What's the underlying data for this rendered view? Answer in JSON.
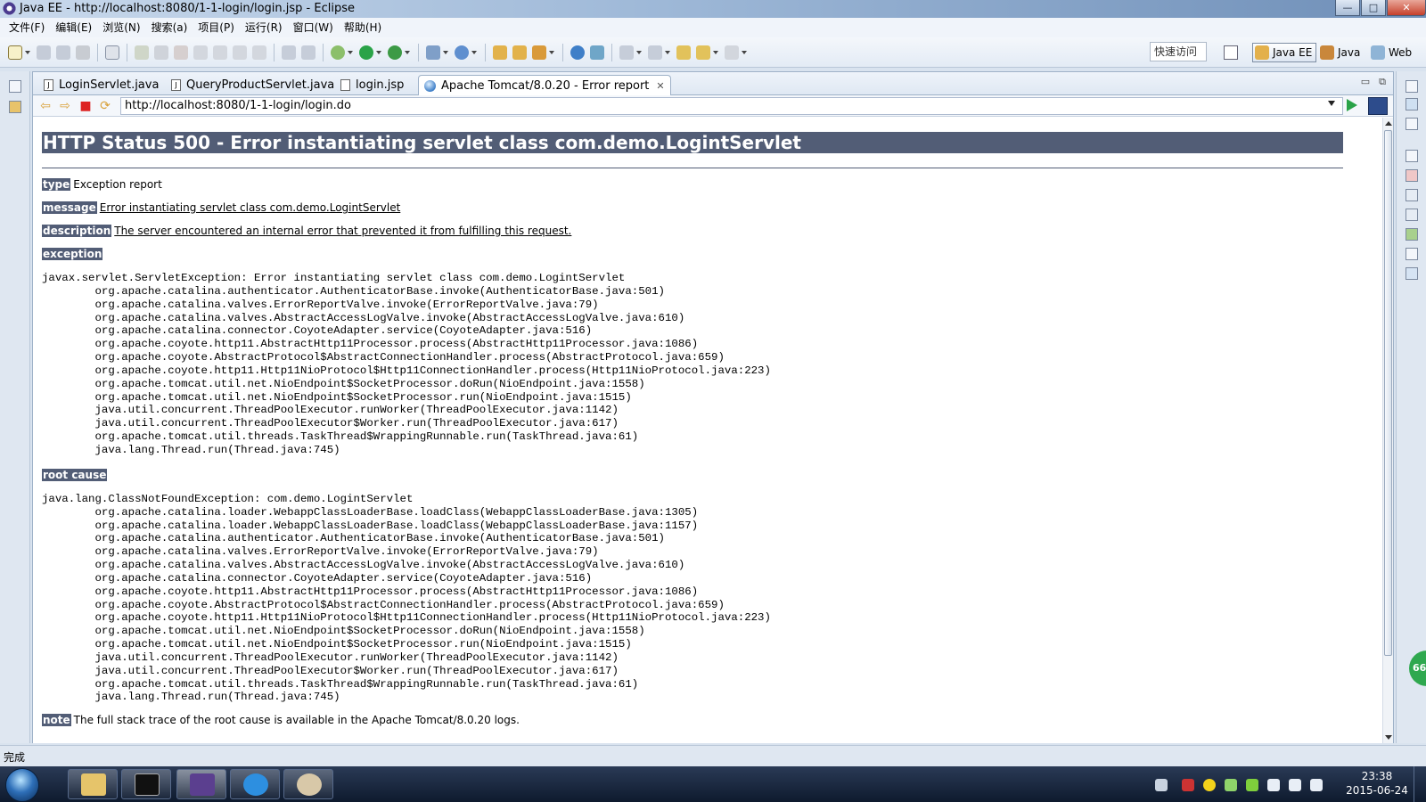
{
  "window": {
    "title": "Java EE - http://localhost:8080/1-1-login/login.jsp - Eclipse",
    "controls": [
      "—",
      "□",
      "✕"
    ]
  },
  "menu": [
    "文件(F)",
    "编辑(E)",
    "浏览(N)",
    "搜索(a)",
    "项目(P)",
    "运行(R)",
    "窗口(W)",
    "帮助(H)"
  ],
  "toolbar": {
    "quick_access": "快速访问",
    "perspectives": [
      "Java EE",
      "Java",
      "Web"
    ]
  },
  "tabs": [
    {
      "label": "LoginServlet.java",
      "icon": "java-file-icon"
    },
    {
      "label": "QueryProductServlet.java",
      "icon": "java-file-icon"
    },
    {
      "label": "login.jsp",
      "icon": "jsp-file-icon"
    },
    {
      "label": "Apache Tomcat/8.0.20 - Error report",
      "icon": "globe-icon",
      "active": true
    }
  ],
  "browser": {
    "url": "http://localhost:8080/1-1-login/login.do"
  },
  "error_page": {
    "heading": "HTTP Status 500 - Error instantiating servlet class com.demo.LogintServlet",
    "type_label": "type",
    "type_value": "Exception report",
    "message_label": "message",
    "message_value": "Error instantiating servlet class com.demo.LogintServlet",
    "description_label": "description",
    "description_value": "The server encountered an internal error that prevented it from fulfilling this request.",
    "exception_label": "exception",
    "exception_lines": [
      "javax.servlet.ServletException: Error instantiating servlet class com.demo.LogintServlet",
      "\torg.apache.catalina.authenticator.AuthenticatorBase.invoke(AuthenticatorBase.java:501)",
      "\torg.apache.catalina.valves.ErrorReportValve.invoke(ErrorReportValve.java:79)",
      "\torg.apache.catalina.valves.AbstractAccessLogValve.invoke(AbstractAccessLogValve.java:610)",
      "\torg.apache.catalina.connector.CoyoteAdapter.service(CoyoteAdapter.java:516)",
      "\torg.apache.coyote.http11.AbstractHttp11Processor.process(AbstractHttp11Processor.java:1086)",
      "\torg.apache.coyote.AbstractProtocol$AbstractConnectionHandler.process(AbstractProtocol.java:659)",
      "\torg.apache.coyote.http11.Http11NioProtocol$Http11ConnectionHandler.process(Http11NioProtocol.java:223)",
      "\torg.apache.tomcat.util.net.NioEndpoint$SocketProcessor.doRun(NioEndpoint.java:1558)",
      "\torg.apache.tomcat.util.net.NioEndpoint$SocketProcessor.run(NioEndpoint.java:1515)",
      "\tjava.util.concurrent.ThreadPoolExecutor.runWorker(ThreadPoolExecutor.java:1142)",
      "\tjava.util.concurrent.ThreadPoolExecutor$Worker.run(ThreadPoolExecutor.java:617)",
      "\torg.apache.tomcat.util.threads.TaskThread$WrappingRunnable.run(TaskThread.java:61)",
      "\tjava.lang.Thread.run(Thread.java:745)"
    ],
    "root_cause_label": "root cause",
    "root_cause_lines": [
      "java.lang.ClassNotFoundException: com.demo.LogintServlet",
      "\torg.apache.catalina.loader.WebappClassLoaderBase.loadClass(WebappClassLoaderBase.java:1305)",
      "\torg.apache.catalina.loader.WebappClassLoaderBase.loadClass(WebappClassLoaderBase.java:1157)",
      "\torg.apache.catalina.authenticator.AuthenticatorBase.invoke(AuthenticatorBase.java:501)",
      "\torg.apache.catalina.valves.ErrorReportValve.invoke(ErrorReportValve.java:79)",
      "\torg.apache.catalina.valves.AbstractAccessLogValve.invoke(AbstractAccessLogValve.java:610)",
      "\torg.apache.catalina.connector.CoyoteAdapter.service(CoyoteAdapter.java:516)",
      "\torg.apache.coyote.http11.AbstractHttp11Processor.process(AbstractHttp11Processor.java:1086)",
      "\torg.apache.coyote.AbstractProtocol$AbstractConnectionHandler.process(AbstractProtocol.java:659)",
      "\torg.apache.coyote.http11.Http11NioProtocol$Http11ConnectionHandler.process(Http11NioProtocol.java:223)",
      "\torg.apache.tomcat.util.net.NioEndpoint$SocketProcessor.doRun(NioEndpoint.java:1558)",
      "\torg.apache.tomcat.util.net.NioEndpoint$SocketProcessor.run(NioEndpoint.java:1515)",
      "\tjava.util.concurrent.ThreadPoolExecutor.runWorker(ThreadPoolExecutor.java:1142)",
      "\tjava.util.concurrent.ThreadPoolExecutor$Worker.run(ThreadPoolExecutor.java:617)",
      "\torg.apache.tomcat.util.threads.TaskThread$WrappingRunnable.run(TaskThread.java:61)",
      "\tjava.lang.Thread.run(Thread.java:745)"
    ],
    "note_label": "note",
    "note_value": "The full stack trace of the root cause is available in the Apache Tomcat/8.0.20 logs."
  },
  "status": {
    "text": "完成"
  },
  "taskbar": {
    "time": "23:38",
    "date": "2015-06-24",
    "side_badge": "66"
  },
  "colors": {
    "tomcat_heading_bg": "#525d76",
    "run_green": "#2aa348"
  }
}
